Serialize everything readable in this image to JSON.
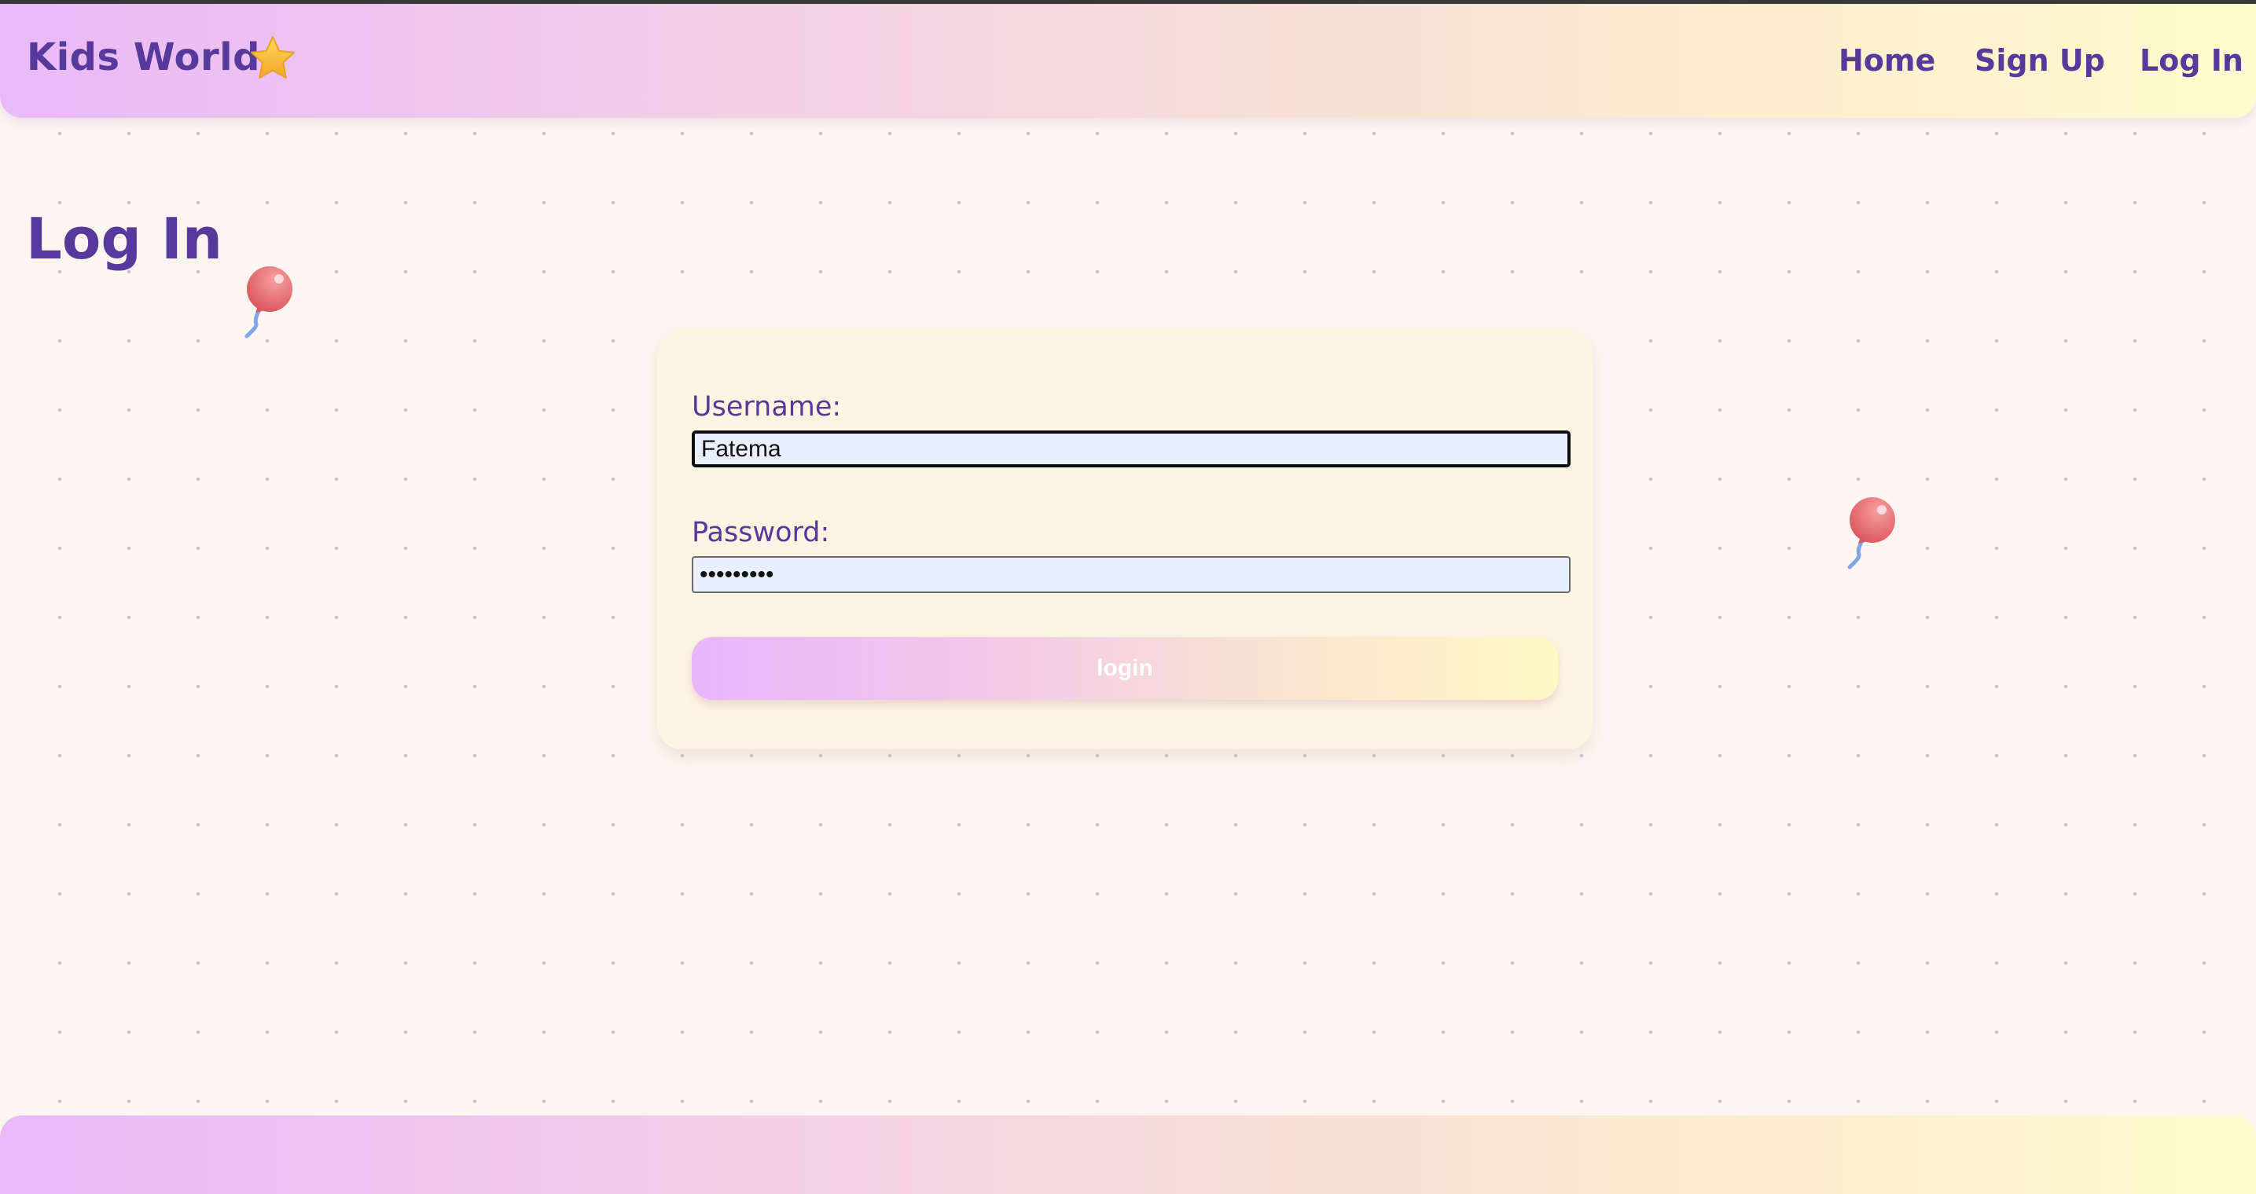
{
  "brand": {
    "name": "Kids World",
    "accent_color": "#56399a",
    "logo_icon": "star-icon"
  },
  "nav": {
    "items": [
      "Home",
      "Sign Up",
      "Log In"
    ]
  },
  "page": {
    "title": "Log In"
  },
  "form": {
    "username_label": "Username:",
    "username_value": "Fatema",
    "password_label": "Password:",
    "password_value": "•••••••••",
    "submit_label": "login"
  },
  "decorations": {
    "balloon_icon": "balloon-icon",
    "balloon_color": "#e86a6e"
  }
}
